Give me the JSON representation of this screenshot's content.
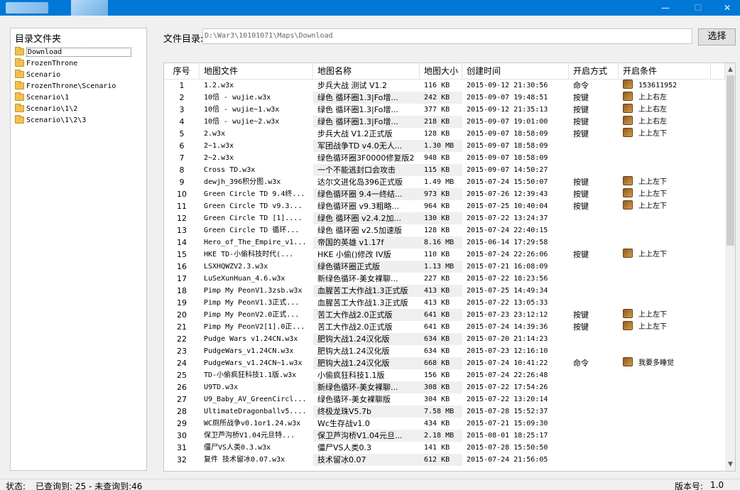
{
  "colors": {
    "titlebar": "#0078d7",
    "condition_icon": "#b07a34"
  },
  "window": {
    "minimize": "—",
    "maximize": "☐",
    "close": "✕"
  },
  "tree": {
    "title": "目录文件夹",
    "items": [
      {
        "label": "Download"
      },
      {
        "label": "FrozenThrone"
      },
      {
        "label": "Scenario"
      },
      {
        "label": "FrozenThrone\\Scenario"
      },
      {
        "label": "Scenario\\1"
      },
      {
        "label": "Scenario\\1\\2"
      },
      {
        "label": "Scenario\\1\\2\\3"
      }
    ]
  },
  "path": {
    "label": "文件目录:",
    "value": "D:\\War3\\10101071\\Maps\\Download",
    "button": "选择"
  },
  "grid": {
    "headers": [
      "序号",
      "地图文件",
      "地图名称",
      "地图大小",
      "创建时间",
      "开启方式",
      "开启条件"
    ],
    "rows": [
      [
        "1",
        "1.2.w3x",
        "步兵大战 测试 V1.2",
        "116 KB",
        "2015-09-12 21:30:56",
        "命令",
        "153611952"
      ],
      [
        "2",
        "10倍 - wujie.w3x",
        "绿色 循环圈1.3|Fo增...",
        "242 KB",
        "2015-09-07 19:48:51",
        "按键",
        "上上右左"
      ],
      [
        "3",
        "10倍 - wujie~1.w3x",
        "绿色 循环圈1.3|Fo增...",
        "377 KB",
        "2015-09-12 21:35:13",
        "按键",
        "上上右左"
      ],
      [
        "4",
        "10倍 - wujie~2.w3x",
        "绿色 循环圈1.3|Fo增...",
        "218 KB",
        "2015-09-07 19:01:00",
        "按键",
        "上上右左"
      ],
      [
        "5",
        "2.w3x",
        "步兵大战 V1.2正式版",
        "128 KB",
        "2015-09-07 18:58:09",
        "按键",
        "上上左下"
      ],
      [
        "6",
        "2~1.w3x",
        "军团战争TD v4.0无人...",
        "1.30 MB",
        "2015-09-07 18:58:09",
        "",
        ""
      ],
      [
        "7",
        "2~2.w3x",
        "绿色循环圈3F0000修复版2",
        "948 KB",
        "2015-09-07 18:58:09",
        "",
        ""
      ],
      [
        "8",
        "Cross TD.w3x",
        "一个不能逃封口会攻击",
        "115 KB",
        "2015-09-07 14:50:27",
        "",
        ""
      ],
      [
        "9",
        "dewjh_396积分图.w3x",
        "达尔文进化岛396正式版",
        "1.49 MB",
        "2015-07-24 15:50:07",
        "按键",
        "上上左下"
      ],
      [
        "10",
        "Green Circle TD 9.4终...",
        "绿色循环圈 9.4一终结...",
        "973 KB",
        "2015-07-26 12:39:43",
        "按键",
        "上上左下"
      ],
      [
        "11",
        "Green Circle TD v9.3...",
        "绿色循环圈 v9.3粗略...",
        "964 KB",
        "2015-07-25 10:40:04",
        "按键",
        "上上左下"
      ],
      [
        "12",
        "Green Circle TD [1]....",
        "绿色 循环圈 v2.4.2加...",
        "130 KB",
        "2015-07-22 13:24:37",
        "",
        ""
      ],
      [
        "13",
        "Green Circle TD 循环...",
        "绿色 循环圈 v2.5加速版",
        "128 KB",
        "2015-07-24 22:40:15",
        "",
        ""
      ],
      [
        "14",
        "Hero_of_The_Empire_v1...",
        "帝国的英雄 v1.17f",
        "8.16 MB",
        "2015-06-14 17:29:58",
        "",
        ""
      ],
      [
        "15",
        "HKE TD-小偷科技时代(...",
        "HKE 小偷()修改 IV版",
        "110 KB",
        "2015-07-24 22:26:06",
        "按键",
        "上上左下"
      ],
      [
        "16",
        "LSXHQWZV2.3.w3x",
        "绿色循环圈正式版",
        "1.13 MB",
        "2015-07-21 16:08:09",
        "",
        ""
      ],
      [
        "17",
        "LuSeXunHuan_4.6.w3x",
        "新绿色循环-美女裸聊...",
        "227 KB",
        "2015-07-22 18:23:56",
        "",
        ""
      ],
      [
        "18",
        "Pimp My PeonV1.3zsb.w3x",
        "血腥苦工大作战1.3正式版",
        "413 KB",
        "2015-07-25 14:49:34",
        "",
        ""
      ],
      [
        "19",
        "Pimp My PeonV1.3正式...",
        "血腥苦工大作战1.3正式版",
        "413 KB",
        "2015-07-22 13:05:33",
        "",
        ""
      ],
      [
        "20",
        "Pimp My PeonV2.0正式...",
        "苦工大作战2.0正式版",
        "641 KB",
        "2015-07-23 23:12:12",
        "按键",
        "上上左下"
      ],
      [
        "21",
        "Pimp My PeonV2[1].0正...",
        "苦工大作战2.0正式版",
        "641 KB",
        "2015-07-24 14:39:36",
        "按键",
        "上上左下"
      ],
      [
        "22",
        "Pudge Wars v1.24CN.w3x",
        "肥钩大战1.24汉化版",
        "634 KB",
        "2015-07-20 21:14:23",
        "",
        ""
      ],
      [
        "23",
        "PudgeWars_v1.24CN.w3x",
        "肥钩大战1.24汉化版",
        "634 KB",
        "2015-07-23 12:16:10",
        "",
        ""
      ],
      [
        "24",
        "PudgeWars_v1.24CN~1.w3x",
        "肥钩大战1.24汉化版",
        "668 KB",
        "2015-07-24 10:41:22",
        "命令",
        "我要多睡觉"
      ],
      [
        "25",
        "TD-小偷疯狂科技1.1版.w3x",
        "小偷疯狂科技1.1版",
        "156 KB",
        "2015-07-24 22:26:48",
        "",
        ""
      ],
      [
        "26",
        "U9TD.w3x",
        "新绿色循环-美女裸聊...",
        "308 KB",
        "2015-07-22 17:54:26",
        "",
        ""
      ],
      [
        "27",
        "U9_Baby_AV_GreenCircl...",
        "绿色循环-美女裸聊版",
        "304 KB",
        "2015-07-22 13:20:14",
        "",
        ""
      ],
      [
        "28",
        "UltimateDragonballv5....",
        "终极龙珠V5.7b",
        "7.58 MB",
        "2015-07-28 15:52:37",
        "",
        ""
      ],
      [
        "29",
        "WC厕所战争v0.1or1.24.w3x",
        "Wc生存战v1.0",
        "434 KB",
        "2015-07-21 15:09:30",
        "",
        ""
      ],
      [
        "30",
        "保卫芦沟桥V1.04元旦特...",
        "保卫芦沟桥V1.04元旦...",
        "2.18 MB",
        "2015-08-01 18:25:17",
        "",
        ""
      ],
      [
        "31",
        "僵尸VS人类0.3.w3x",
        "僵尸VS人类0.3",
        "141 KB",
        "2015-07-28 15:50:50",
        "",
        ""
      ],
      [
        "32",
        "复件 技术留冰0.07.w3x",
        "技术留冰0.07",
        "612 KB",
        "2015-07-24 21:56:05",
        "",
        ""
      ]
    ]
  },
  "status": {
    "label": "状态:",
    "text": "已查询到: 25 - 未查询到:46",
    "version_label": "版本号:",
    "version": "1.0"
  }
}
